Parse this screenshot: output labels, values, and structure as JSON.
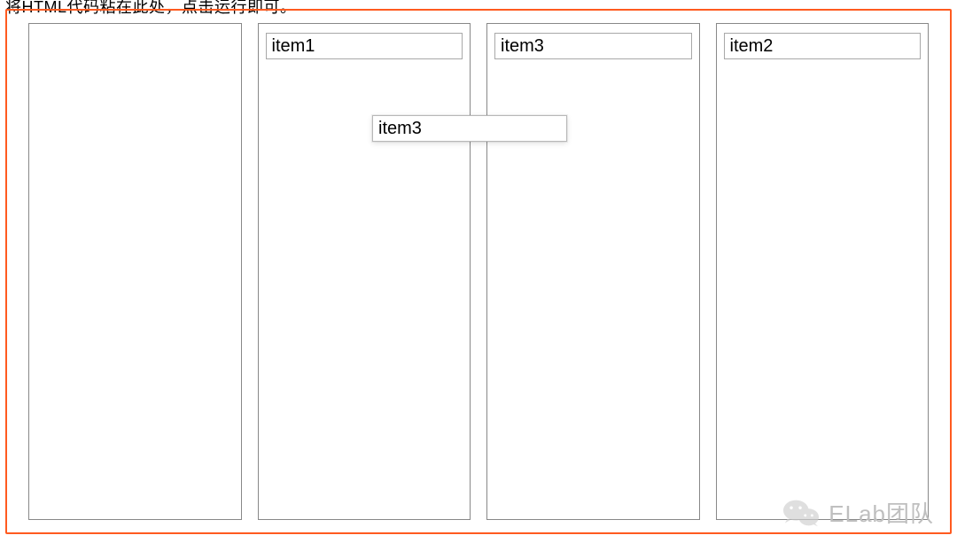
{
  "header": {
    "partial_text": "将HTML代码粘在此处，点击运行即可。"
  },
  "columns": [
    {
      "items": []
    },
    {
      "items": [
        {
          "label": "item1"
        }
      ]
    },
    {
      "items": [
        {
          "label": "item3"
        }
      ]
    },
    {
      "items": [
        {
          "label": "item2"
        }
      ]
    }
  ],
  "drag_ghost": {
    "label": "item3"
  },
  "watermark": {
    "text": "ELab团队",
    "icon": "wechat-icon"
  }
}
